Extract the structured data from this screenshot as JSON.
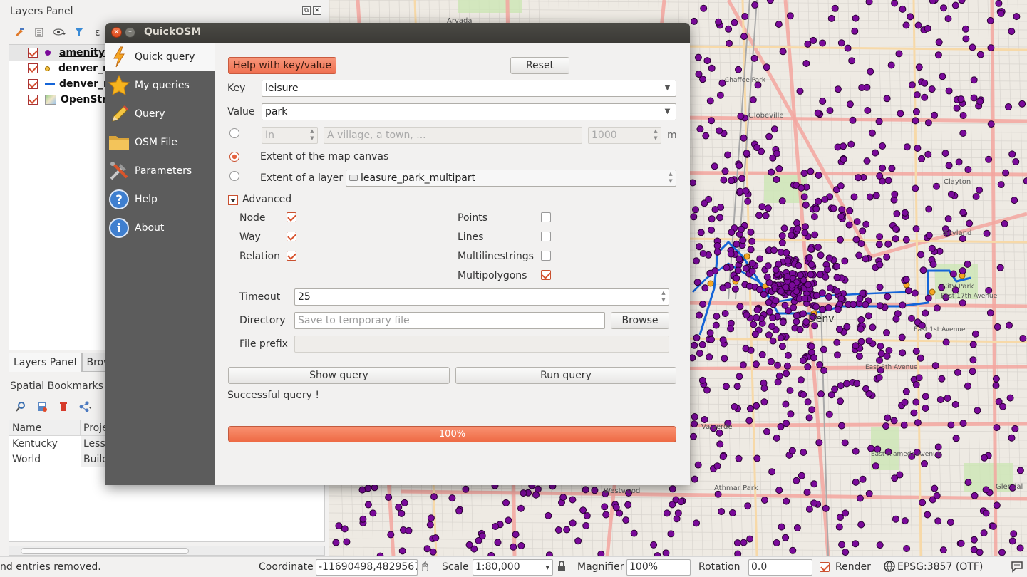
{
  "left_dock": {
    "title": "Layers Panel",
    "layers": [
      {
        "name": "amenity",
        "symbol": "purple-dot-icon",
        "checked": true
      },
      {
        "name": "denver_m",
        "symbol": "orange-dot-icon",
        "checked": true
      },
      {
        "name": "denver_m",
        "symbol": "blue-line-icon",
        "checked": true
      },
      {
        "name": "OpenStre",
        "symbol": "raster-icon",
        "checked": true
      }
    ],
    "tabs": [
      "Layers Panel",
      "Brow"
    ],
    "bookmarks_title": "Spatial Bookmarks P",
    "bookmarks_headers": [
      "Name",
      "Proje"
    ],
    "bookmarks_rows": [
      [
        "Kentucky",
        "Lesso"
      ],
      [
        "World",
        "Build"
      ]
    ]
  },
  "dialog": {
    "title": "QuickOSM",
    "nav": [
      {
        "label": "Quick query",
        "icon": "lightning-icon"
      },
      {
        "label": "My queries",
        "icon": "star-icon"
      },
      {
        "label": "Query",
        "icon": "pencil-icon"
      },
      {
        "label": "OSM File",
        "icon": "folder-icon"
      },
      {
        "label": "Parameters",
        "icon": "tools-icon"
      },
      {
        "label": "Help",
        "icon": "help-icon"
      },
      {
        "label": "About",
        "icon": "info-icon"
      }
    ],
    "help_button": "Help with key/value",
    "reset_button": "Reset",
    "key_label": "Key",
    "key_value": "leisure",
    "value_label": "Value",
    "value_value": "park",
    "in_select": "In",
    "place_placeholder": "A village, a town, ...",
    "distance": "1000",
    "distance_unit": "m",
    "extent_canvas_label": "Extent of the map canvas",
    "extent_layer_label": "Extent of a layer",
    "extent_layer_value": "leasure_park_multipart",
    "advanced_label": "Advanced",
    "osm_types": [
      {
        "label": "Node",
        "checked": true
      },
      {
        "label": "Way",
        "checked": true
      },
      {
        "label": "Relation",
        "checked": true
      }
    ],
    "geometries": [
      {
        "label": "Points",
        "checked": false
      },
      {
        "label": "Lines",
        "checked": false
      },
      {
        "label": "Multilinestrings",
        "checked": false
      },
      {
        "label": "Multipolygons",
        "checked": true
      }
    ],
    "timeout_label": "Timeout",
    "timeout_value": "25",
    "directory_label": "Directory",
    "directory_placeholder": "Save to temporary file",
    "browse_button": "Browse",
    "prefix_label": "File prefix",
    "show_query_button": "Show query",
    "run_query_button": "Run query",
    "status_message": "Successful query !",
    "progress": 1.0,
    "progress_text": "100%"
  },
  "statusbar": {
    "message": "nd entries removed.",
    "coordinate_label": "Coordinate",
    "coordinate_value": "-11690498,4829567",
    "scale_label": "Scale",
    "scale_value": "1:80,000",
    "magnifier_label": "Magnifier",
    "magnifier_value": "100%",
    "rotation_label": "Rotation",
    "rotation_value": "0.0",
    "render_label": "Render",
    "crs": "EPSG:3857 (OTF)"
  },
  "map": {
    "place_labels": [
      "Denv",
      "Arvada",
      "Globeville",
      "City Park",
      "Clayton",
      "Skyland",
      "Westwood",
      "Athmar Park",
      "Valverde",
      "Glendal",
      "East 8th Avenue",
      "East 1st Avenue",
      "East Alameda Avenue",
      "East 17th Avenue",
      "Chaffee Park"
    ],
    "colors": {
      "points": "#7a0a9a",
      "lines": "#1565d8",
      "nodes": "#f5a623",
      "major_roads": "#f4a6a0",
      "parks": "#cce6b4"
    }
  }
}
